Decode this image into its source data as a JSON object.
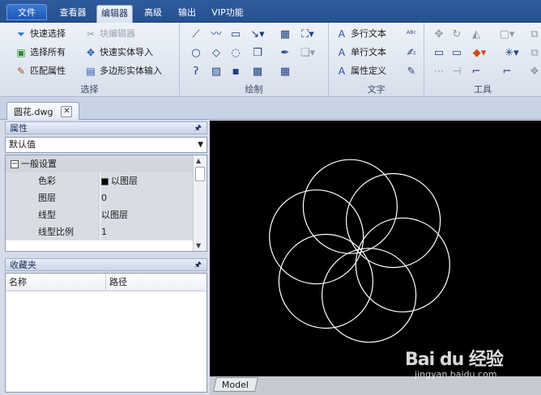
{
  "menu": {
    "tabs": [
      "文件",
      "查看器",
      "编辑器",
      "高级",
      "输出",
      "VIP功能"
    ],
    "active_index": 2
  },
  "ribbon": {
    "select_group": {
      "label": "选择",
      "quick_select": "快速选择",
      "select_all": "选择所有",
      "match_props": "匹配属性",
      "block_editor": "块编辑器",
      "quick_entity_import": "快速实体导入",
      "polygon_entity_input": "多边形实体输入"
    },
    "draw_group": {
      "label": "绘制"
    },
    "text_group": {
      "label": "文字",
      "mtext": "多行文本",
      "text": "单行文本",
      "attdef": "属性定义"
    },
    "tools_group": {
      "label": "工具"
    }
  },
  "document": {
    "tab_name": "圆花.dwg",
    "close_symbol": "✕"
  },
  "properties": {
    "title": "属性",
    "selector_value": "默认值",
    "category": "一般设置",
    "rows": [
      {
        "key": "色彩",
        "value": "以图层"
      },
      {
        "key": "图层",
        "value": "0"
      },
      {
        "key": "线型",
        "value": "以图层"
      },
      {
        "key": "线型比例",
        "value": "1"
      }
    ]
  },
  "favorites": {
    "title": "收藏夹",
    "columns": [
      "名称",
      "路径"
    ]
  },
  "canvas": {
    "layout_tab": "Model",
    "background_color": "#000000",
    "stroke_color": "#ffffff"
  },
  "watermark": {
    "brand": "Bai du 经验",
    "url": "jingyan.baidu.com"
  }
}
